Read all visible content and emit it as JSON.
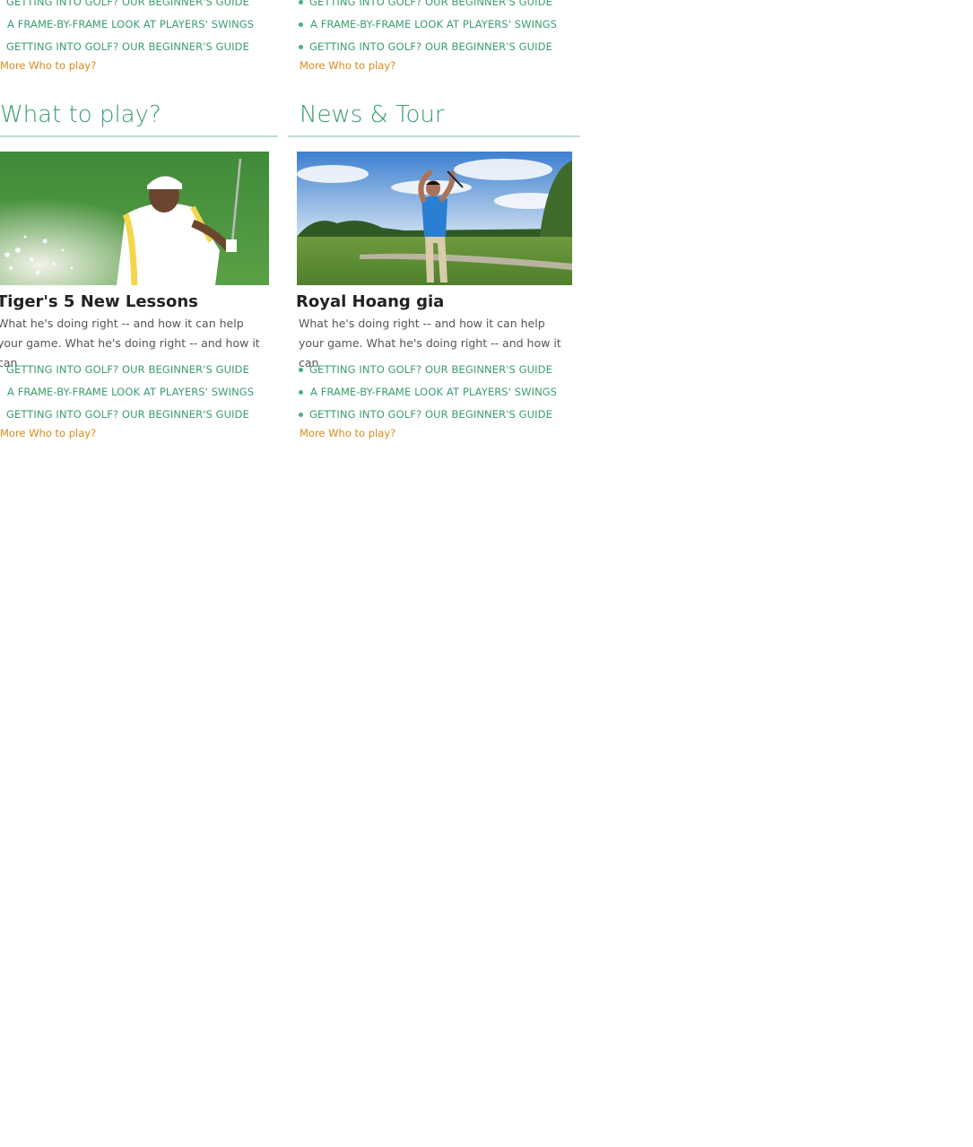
{
  "top_sections": [
    {
      "links": [
        "GETTING INTO GOLF? OUR BEGINNER'S GUIDE",
        "A FRAME-BY-FRAME LOOK AT PLAYERS' SWINGS",
        "GETTING INTO GOLF? OUR BEGINNER'S GUIDE"
      ],
      "more_label": "More Who to play?"
    },
    {
      "links": [
        "GETTING INTO GOLF? OUR BEGINNER'S GUIDE",
        "A FRAME-BY-FRAME LOOK AT PLAYERS' SWINGS",
        "GETTING INTO GOLF? OUR BEGINNER'S GUIDE"
      ],
      "more_label": "More Who to play?"
    }
  ],
  "sections": [
    {
      "title": "What to play?",
      "article": {
        "image_icon": "golfer-bunker-shot-photo",
        "title": "Tiger's 5 New Lessons",
        "description": "What he's doing right -- and how it can help your game. What he's doing right -- and how it can"
      },
      "links": [
        "GETTING INTO GOLF? OUR BEGINNER'S GUIDE",
        "A FRAME-BY-FRAME LOOK AT PLAYERS' SWINGS",
        "GETTING INTO GOLF? OUR BEGINNER'S GUIDE"
      ],
      "more_label": "More Who to play?"
    },
    {
      "title": "News & Tour",
      "article": {
        "image_icon": "golfer-swing-course-photo",
        "title": "Royal Hoang gia",
        "description": "What he's doing right -- and how it can help your game. What he's doing right -- and how it can"
      },
      "links": [
        "GETTING INTO GOLF? OUR BEGINNER'S GUIDE",
        "A FRAME-BY-FRAME LOOK AT PLAYERS' SWINGS",
        "GETTING INTO GOLF? OUR BEGINNER'S GUIDE"
      ],
      "more_label": "More Who to play?"
    }
  ],
  "colors": {
    "accent_green": "#3a9d6e",
    "rule_green": "#b9e0cb",
    "more_orange": "#d98a1a",
    "title_text": "#222222",
    "body_text": "#555555"
  }
}
